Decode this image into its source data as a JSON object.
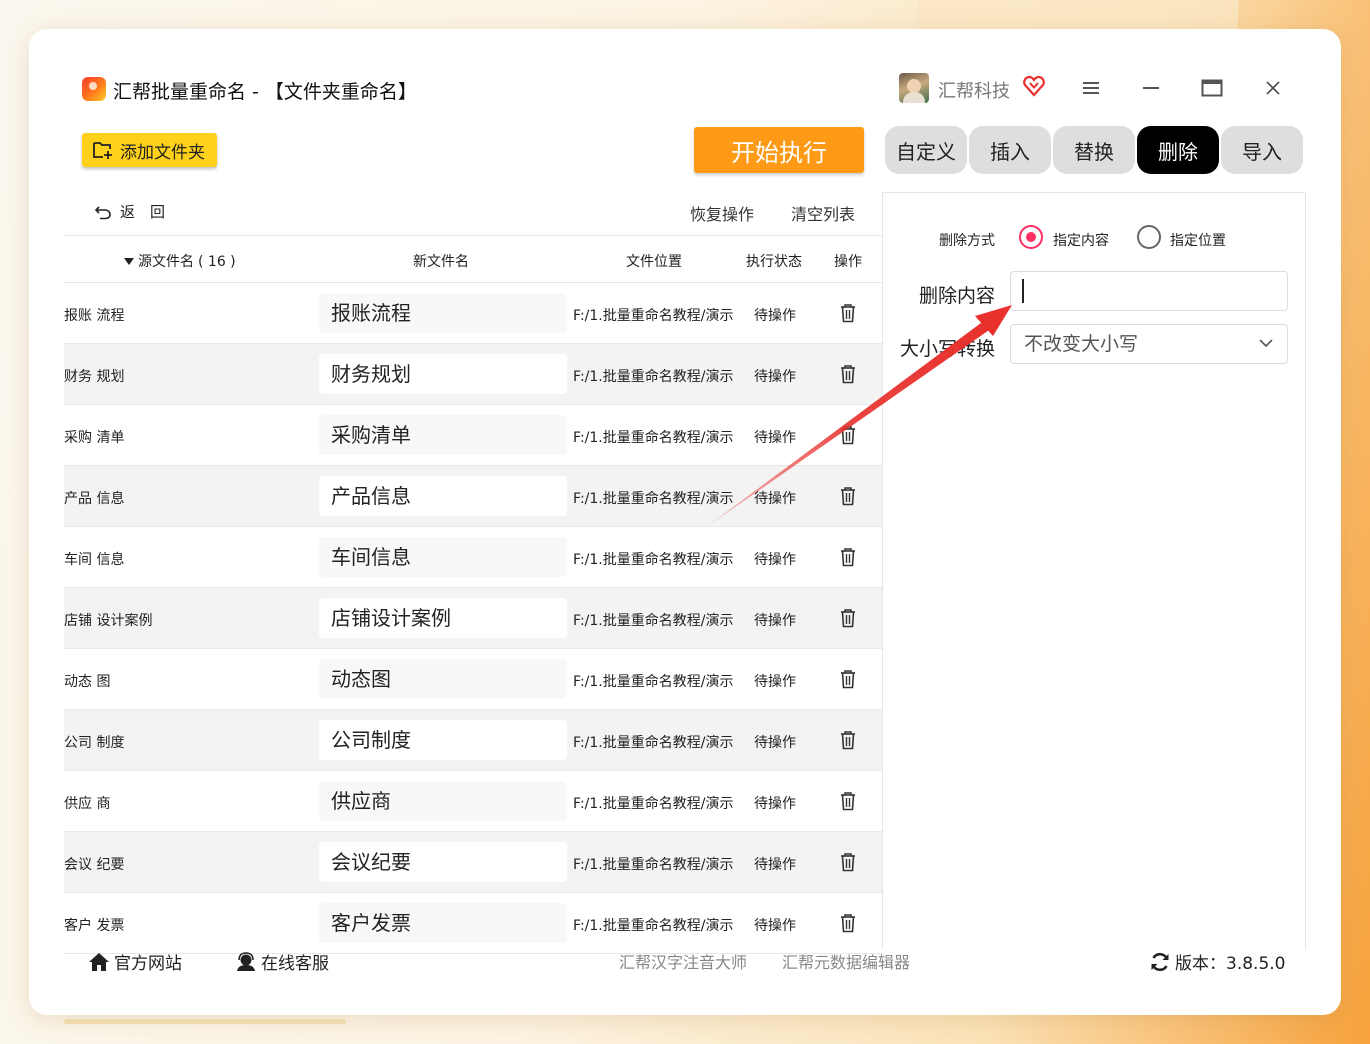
{
  "app": {
    "title": "汇帮批量重命名 - 【文件夹重命名】",
    "user_name": "汇帮科技"
  },
  "toolbar": {
    "add_folder_label": "添加文件夹",
    "start_label": "开始执行",
    "tabs": [
      {
        "label": "自定义",
        "active": false
      },
      {
        "label": "插入",
        "active": false
      },
      {
        "label": "替换",
        "active": false
      },
      {
        "label": "删除",
        "active": true
      },
      {
        "label": "导入",
        "active": false
      }
    ]
  },
  "list": {
    "back_label": "返　回",
    "restore_label": "恢复操作",
    "clear_label": "清空列表",
    "columns": {
      "source": "源文件名",
      "count": "( 16 )",
      "new_name": "新文件名",
      "location": "文件位置",
      "status": "执行状态",
      "action": "操作"
    },
    "rows": [
      {
        "source": "报账  流程",
        "new_name": "报账流程",
        "location": "F:/1.批量重命名教程/演示",
        "status": "待操作"
      },
      {
        "source": "财务  规划",
        "new_name": "财务规划",
        "location": "F:/1.批量重命名教程/演示",
        "status": "待操作"
      },
      {
        "source": "采购  清单",
        "new_name": "采购清单",
        "location": "F:/1.批量重命名教程/演示",
        "status": "待操作"
      },
      {
        "source": "产品  信息",
        "new_name": "产品信息",
        "location": "F:/1.批量重命名教程/演示",
        "status": "待操作"
      },
      {
        "source": "车间  信息",
        "new_name": "车间信息",
        "location": "F:/1.批量重命名教程/演示",
        "status": "待操作"
      },
      {
        "source": "店铺  设计案例",
        "new_name": "店铺设计案例",
        "location": "F:/1.批量重命名教程/演示",
        "status": "待操作"
      },
      {
        "source": "动态  图",
        "new_name": "动态图",
        "location": "F:/1.批量重命名教程/演示",
        "status": "待操作"
      },
      {
        "source": "公司  制度",
        "new_name": "公司制度",
        "location": "F:/1.批量重命名教程/演示",
        "status": "待操作"
      },
      {
        "source": "供应  商",
        "new_name": "供应商",
        "location": "F:/1.批量重命名教程/演示",
        "status": "待操作"
      },
      {
        "source": "会议  纪要",
        "new_name": "会议纪要",
        "location": "F:/1.批量重命名教程/演示",
        "status": "待操作"
      },
      {
        "source": "客户  发票",
        "new_name": "客户发票",
        "location": "F:/1.批量重命名教程/演示",
        "status": "待操作"
      }
    ]
  },
  "delete_panel": {
    "method_label": "删除方式",
    "options": [
      {
        "label": "指定内容",
        "selected": true
      },
      {
        "label": "指定位置",
        "selected": false
      }
    ],
    "content_label": "删除内容",
    "content_value": "",
    "case_label": "大小写转换",
    "case_value": "不改变大小写"
  },
  "footer": {
    "site": "官方网站",
    "service": "在线客服",
    "pinyin_app": "汇帮汉字注音大师",
    "meta_app": "汇帮元数据编辑器",
    "version": "版本：3.8.5.0"
  },
  "colors": {
    "accent_yellow": "#ffd11a",
    "accent_orange": "#ff9a16",
    "radio_active": "#ff2e63",
    "annotation_arrow": "#e8302c"
  },
  "icons": {
    "vip": "heart-diamond-icon",
    "menu": "hamburger-icon",
    "minimize": "minimize-icon",
    "maximize": "maximize-icon",
    "close": "close-icon",
    "add_folder": "folder-plus-icon",
    "back": "undo-icon",
    "delete": "trash-icon",
    "home": "home-icon",
    "service": "headset-icon",
    "refresh": "refresh-icon"
  }
}
